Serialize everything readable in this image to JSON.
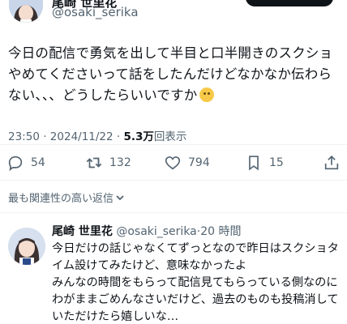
{
  "main_tweet": {
    "author_name_partial": "尾崎 世里花",
    "handle": "@osaki_serika",
    "text": "今日の配信で勇気を出して半目と口半開きのスクショやめてくださいって話をしたんだけどなかなか伝わらない、、、どうしたらいいですか",
    "emoji": "worried-face",
    "time": "23:50",
    "date": "2024/11/22",
    "separator": "·",
    "views_count": "5.3万",
    "views_label": "回表示"
  },
  "actions": {
    "reply_count": "54",
    "retweet_count": "132",
    "like_count": "794",
    "bookmark_count": "15"
  },
  "sort": {
    "label": "最も関連性の高い返信"
  },
  "reply": {
    "name": "尾崎 世里花",
    "handle": "@osaki_serika",
    "separator": "·",
    "time_ago": "20 時間",
    "text": "今日だけの話じゃなくてずっとなので昨日はスクショタイム設けてみたけど、意味なかったよ\nみんなの時間をもらって配信見てもらっている側なのにわがままごめんなさいだけど、過去のものも投稿消していただけたら嬉しいな…"
  },
  "colors": {
    "text_primary": "#0f1419",
    "text_secondary": "#536471",
    "divider": "#eff3f4"
  }
}
